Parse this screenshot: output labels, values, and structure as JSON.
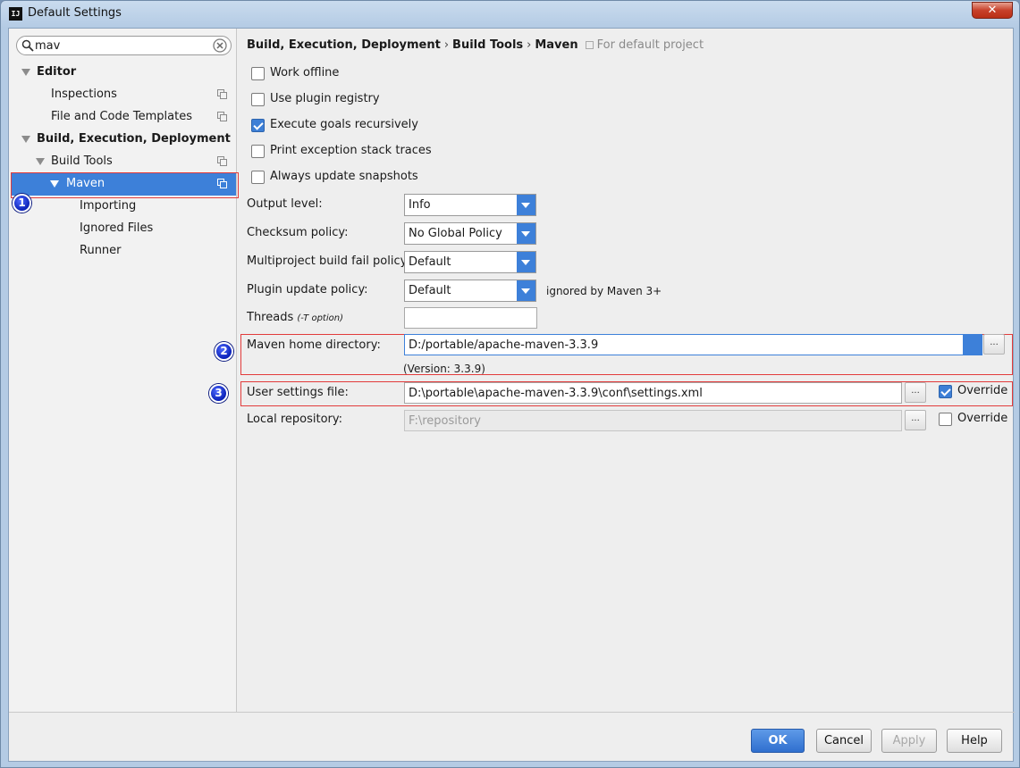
{
  "window": {
    "title": "Default Settings",
    "app_icon_text": "IJ",
    "close_glyph": "✕"
  },
  "search": {
    "value": "mav"
  },
  "tree": {
    "editor": "Editor",
    "inspections": "Inspections",
    "file_templates": "File and Code Templates",
    "build": "Build, Execution, Deployment",
    "build_tools": "Build Tools",
    "maven": "Maven",
    "importing": "Importing",
    "ignored_files": "Ignored Files",
    "runner": "Runner"
  },
  "markers": [
    "1",
    "2",
    "3"
  ],
  "breadcrumb": {
    "part1": "Build, Execution, Deployment",
    "sep": "›",
    "part2": "Build Tools",
    "part3": "Maven",
    "hint": "For default project"
  },
  "checkboxes": {
    "work_offline": {
      "label": "Work offline",
      "checked": false
    },
    "use_plugin_registry": {
      "label": "Use plugin registry",
      "checked": false
    },
    "execute_goals": {
      "label": "Execute goals recursively",
      "checked": true
    },
    "print_exception": {
      "label": "Print exception stack traces",
      "checked": false
    },
    "always_update": {
      "label": "Always update snapshots",
      "checked": false
    }
  },
  "fields": {
    "output_level": {
      "label": "Output level:",
      "value": "Info"
    },
    "checksum_policy": {
      "label": "Checksum policy:",
      "value": "No Global Policy"
    },
    "multiproject_fail": {
      "label": "Multiproject build fail policy:",
      "value": "Default"
    },
    "plugin_update": {
      "label": "Plugin update policy:",
      "value": "Default",
      "note": "ignored by Maven 3+"
    },
    "threads": {
      "label": "Threads",
      "hint": "(-T option)",
      "value": ""
    },
    "maven_home": {
      "label": "Maven home directory:",
      "value": "D:/portable/apache-maven-3.3.9",
      "version": "(Version: 3.3.9)"
    },
    "user_settings": {
      "label": "User settings file:",
      "value": "D:\\portable\\apache-maven-3.3.9\\conf\\settings.xml",
      "override_label": "Override",
      "override": true
    },
    "local_repo": {
      "label": "Local repository:",
      "value": "F:\\repository",
      "override_label": "Override",
      "override": false
    }
  },
  "browse_label": "...",
  "buttons": {
    "ok": "OK",
    "cancel": "Cancel",
    "apply": "Apply",
    "help": "Help"
  },
  "colors": {
    "accent": "#3d80d9",
    "highlight_box": "#e23b3b",
    "marker": "#1a33d6"
  }
}
